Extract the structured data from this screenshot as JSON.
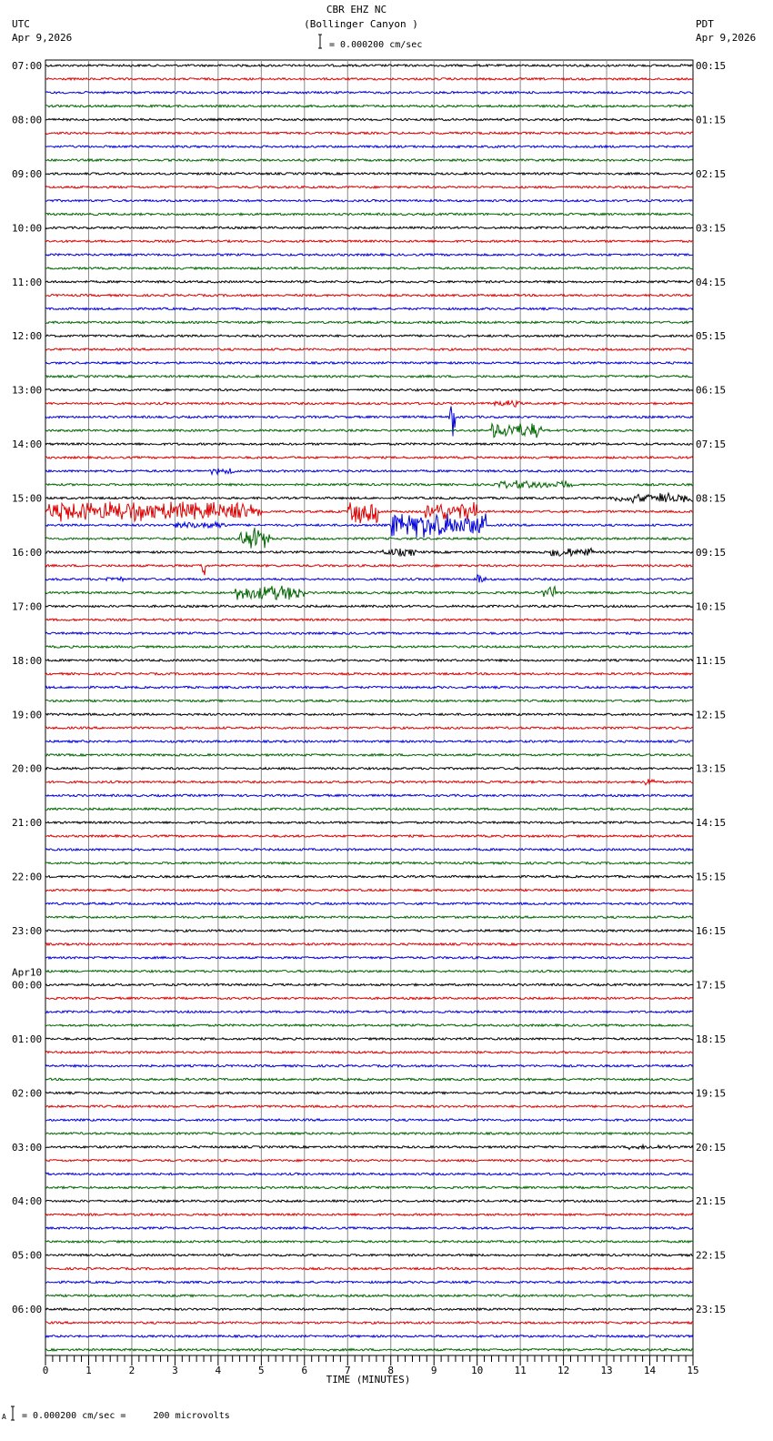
{
  "header": {
    "station": "CBR EHZ NC",
    "location": "(Bollinger Canyon )",
    "left_tz": "UTC",
    "left_date": "Apr 9,2026",
    "right_tz": "PDT",
    "right_date": "Apr 9,2026",
    "scale_text": "= 0.000200 cm/sec"
  },
  "footer": {
    "scale_prefix": "A",
    "scale_text": "= 0.000200 cm/sec =     200 microvolts"
  },
  "chart_data": {
    "type": "line",
    "title": "CBR EHZ NC (Bollinger Canyon )",
    "xlabel": "TIME (MINUTES)",
    "xlim": [
      0,
      15
    ],
    "x_ticks": [
      "0",
      "1",
      "2",
      "3",
      "4",
      "5",
      "6",
      "7",
      "8",
      "9",
      "10",
      "11",
      "12",
      "13",
      "14",
      "15"
    ],
    "trace_colors": [
      "#000000",
      "#dd0000",
      "#0000dd",
      "#006600"
    ],
    "traces_per_hour": 4,
    "date_change_label": "Apr10",
    "utc_labels": [
      "07:00",
      "08:00",
      "09:00",
      "10:00",
      "11:00",
      "12:00",
      "13:00",
      "14:00",
      "15:00",
      "16:00",
      "17:00",
      "18:00",
      "19:00",
      "20:00",
      "21:00",
      "22:00",
      "23:00",
      "00:00",
      "01:00",
      "02:00",
      "03:00",
      "04:00",
      "05:00",
      "06:00"
    ],
    "pdt_labels": [
      "00:15",
      "01:15",
      "02:15",
      "03:15",
      "04:15",
      "05:15",
      "06:15",
      "07:15",
      "08:15",
      "09:15",
      "10:15",
      "11:15",
      "12:15",
      "13:15",
      "14:15",
      "15:15",
      "16:15",
      "17:15",
      "18:15",
      "19:15",
      "20:15",
      "21:15",
      "22:15",
      "23:15"
    ],
    "events": [
      {
        "row": 25,
        "start": 10.4,
        "end": 11.0,
        "amp": 4
      },
      {
        "row": 26,
        "start": 9.35,
        "end": 9.5,
        "amp": 30
      },
      {
        "row": 27,
        "start": 10.3,
        "end": 11.5,
        "amp": 10
      },
      {
        "row": 30,
        "start": 3.8,
        "end": 4.4,
        "amp": 4
      },
      {
        "row": 31,
        "start": 10.5,
        "end": 12.2,
        "amp": 5
      },
      {
        "row": 32,
        "start": 13.2,
        "end": 15.0,
        "amp": 6
      },
      {
        "row": 33,
        "start": 0.0,
        "end": 5.0,
        "amp": 12
      },
      {
        "row": 33,
        "start": 7.0,
        "end": 7.7,
        "amp": 14
      },
      {
        "row": 33,
        "start": 8.8,
        "end": 10.0,
        "amp": 12
      },
      {
        "row": 34,
        "start": 8.0,
        "end": 10.2,
        "amp": 16
      },
      {
        "row": 34,
        "start": 3.0,
        "end": 4.2,
        "amp": 5
      },
      {
        "row": 35,
        "start": 4.5,
        "end": 5.2,
        "amp": 14
      },
      {
        "row": 36,
        "start": 7.8,
        "end": 8.6,
        "amp": 5
      },
      {
        "row": 36,
        "start": 11.7,
        "end": 12.7,
        "amp": 6
      },
      {
        "row": 37,
        "start": 3.6,
        "end": 3.7,
        "amp": 20
      },
      {
        "row": 38,
        "start": 1.4,
        "end": 1.8,
        "amp": 4
      },
      {
        "row": 38,
        "start": 10.0,
        "end": 10.2,
        "amp": 7
      },
      {
        "row": 39,
        "start": 4.4,
        "end": 6.0,
        "amp": 10
      },
      {
        "row": 39,
        "start": 11.5,
        "end": 11.8,
        "amp": 8
      },
      {
        "row": 53,
        "start": 13.9,
        "end": 14.1,
        "amp": 5
      },
      {
        "row": 80,
        "start": 13.5,
        "end": 14.5,
        "amp": 3
      }
    ]
  }
}
